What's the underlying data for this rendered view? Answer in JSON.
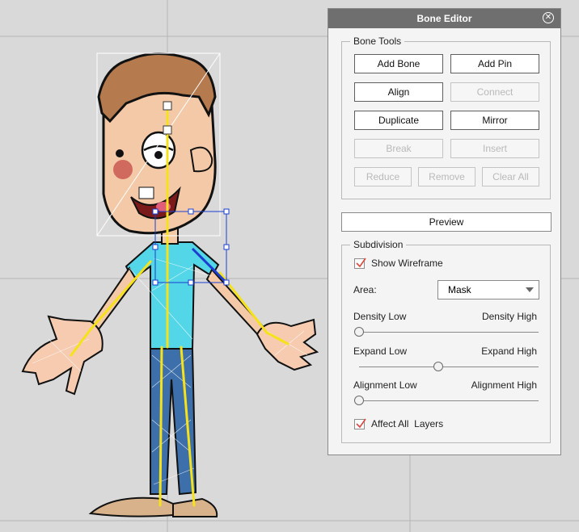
{
  "panel": {
    "title": "Bone Editor",
    "close_icon": "close-circle-icon",
    "bone_tools": {
      "legend": "Bone Tools",
      "buttons": [
        {
          "label": "Add Bone",
          "enabled": true
        },
        {
          "label": "Add Pin",
          "enabled": true
        },
        {
          "label": "Align",
          "enabled": true
        },
        {
          "label": "Connect",
          "enabled": false
        },
        {
          "label": "Duplicate",
          "enabled": true
        },
        {
          "label": "Mirror",
          "enabled": true
        },
        {
          "label": "Break",
          "enabled": false
        },
        {
          "label": "Insert",
          "enabled": false
        },
        {
          "label": "Reduce",
          "enabled": false
        },
        {
          "label": "Remove",
          "enabled": false
        },
        {
          "label": "Clear All",
          "enabled": false
        }
      ]
    },
    "preview_label": "Preview",
    "subdivision": {
      "legend": "Subdivision",
      "show_wireframe_label": "Show Wireframe",
      "show_wireframe_checked": true,
      "area_label": "Area:",
      "area_value": "Mask",
      "density_low": "Density Low",
      "density_high": "Density High",
      "density_value": 0.0,
      "expand_low": "Expand Low",
      "expand_high": "Expand High",
      "expand_value": 0.44,
      "alignment_low": "Alignment Low",
      "alignment_high": "Alignment High",
      "alignment_value": 0.0,
      "affect_all_label": "Affect All  Layers",
      "affect_all_checked": true
    }
  },
  "colors": {
    "panel_bg": "#f4f4f4",
    "title_bar": "#6f6f6f",
    "canvas_bg": "#d9d9d9",
    "check_mark": "#d9473d",
    "bone_yellow": "#f5e21a",
    "bone_blue": "#1b3ed1"
  }
}
